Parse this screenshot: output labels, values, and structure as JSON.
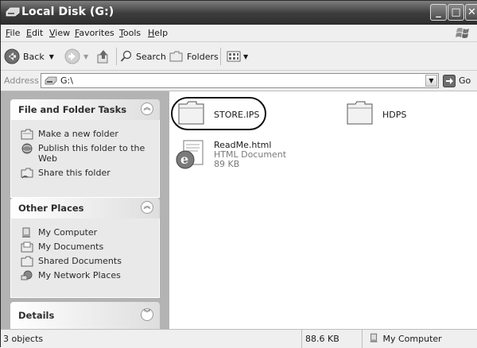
{
  "window": {
    "title": "Local Disk (G:)"
  },
  "menu": [
    "File",
    "Edit",
    "View",
    "Favorites",
    "Tools",
    "Help"
  ],
  "toolbar": {
    "back_label": "Back",
    "search_label": "Search",
    "folders_label": "Folders"
  },
  "address": {
    "label": "Address",
    "value": "G:\\",
    "go_label": "Go"
  },
  "tasks": {
    "title": "File and Folder Tasks",
    "items": [
      {
        "label": "Make a new folder",
        "icon": "new-folder-icon"
      },
      {
        "label": "Publish this folder to the Web",
        "icon": "publish-web-icon"
      },
      {
        "label": "Share this folder",
        "icon": "share-folder-icon"
      }
    ]
  },
  "places": {
    "title": "Other Places",
    "items": [
      {
        "label": "My Computer",
        "icon": "computer-icon"
      },
      {
        "label": "My Documents",
        "icon": "documents-icon"
      },
      {
        "label": "Shared Documents",
        "icon": "shared-folder-icon"
      },
      {
        "label": "My Network Places",
        "icon": "network-icon"
      }
    ]
  },
  "details": {
    "title": "Details"
  },
  "files": [
    {
      "name": "STORE.IPS",
      "kind": "folder"
    },
    {
      "name": "HDPS",
      "kind": "folder"
    },
    {
      "name": "ReadMe.html",
      "kind": "html",
      "type": "HTML Document",
      "size": "89 KB"
    }
  ],
  "status": {
    "objects": "3 objects",
    "size": "88.6 KB",
    "location": "My Computer"
  }
}
